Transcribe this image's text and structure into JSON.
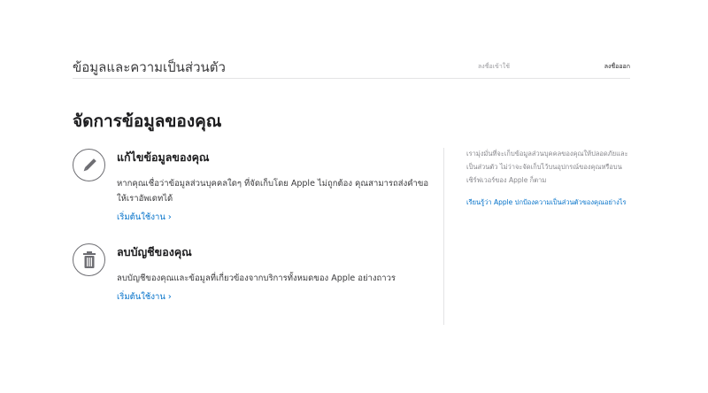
{
  "header": {
    "title": "ข้อมูลและความเป็นส่วนตัว",
    "signin_label": "ลงชื่อเข้าใช้",
    "signout_label": "ลงชื่อออก"
  },
  "main": {
    "heading": "จัดการข้อมูลของคุณ",
    "sections": [
      {
        "icon": "pencil-icon",
        "title": "แก้ไขข้อมูลของคุณ",
        "text": "หากคุณเชื่อว่าข้อมูลส่วนบุคคลใดๆ ที่จัดเก็บโดย Apple ไม่ถูกต้อง คุณสามารถส่งคำขอให้เราอัพเดทได้",
        "link": "เริ่มต้นใช้งาน ›"
      },
      {
        "icon": "trash-icon",
        "title": "ลบบัญชีของคุณ",
        "text": "ลบบัญชีของคุณและข้อมูลที่เกี่ยวข้องจากบริการทั้งหมดของ Apple อย่างถาวร",
        "link": "เริ่มต้นใช้งาน ›"
      }
    ]
  },
  "side": {
    "text": "เรามุ่งมั่นที่จะเก็บข้อมูลส่วนบุคคลของคุณให้ปลอดภัยและเป็นส่วนตัว ไม่ว่าจะจัดเก็บไว้บนอุปกรณ์ของคุณหรือบนเซิร์ฟเวอร์ของ Apple ก็ตาม",
    "link": "เรียนรู้ว่า Apple ปกป้องความเป็นส่วนตัวของคุณอย่างไร"
  },
  "colors": {
    "link": "#0070c9",
    "text": "#1d1d1f",
    "muted": "#86868b",
    "divider": "#e3e3e5"
  }
}
